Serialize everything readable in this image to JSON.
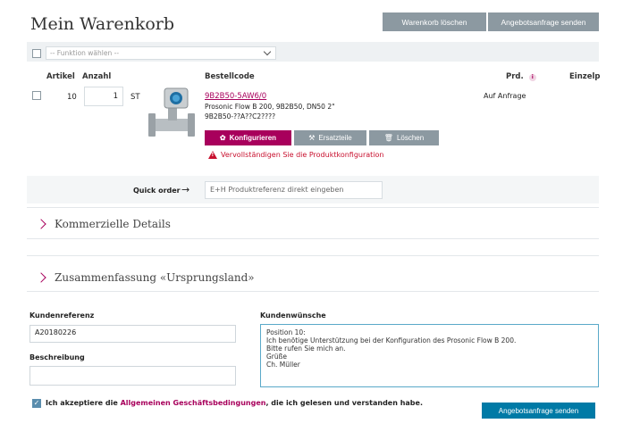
{
  "page": {
    "title": "Mein Warenkorb"
  },
  "toolbar": {
    "clear_cart": "Warenkorb löschen",
    "send_request": "Angebotsanfrage senden"
  },
  "function_select": {
    "placeholder": "-- Funktion wählen --"
  },
  "table": {
    "headers": {
      "item": "Artikel",
      "qty": "Anzahl",
      "code": "Bestellcode",
      "prd": "Prd.",
      "unit_price": "Einzelp"
    },
    "row": {
      "item": "10",
      "qty": "1",
      "unit": "ST",
      "code_link": "9B2B50-5AW6/0",
      "desc1": "Prosonic Flow B 200, 9B2B50, DN50 2\"",
      "desc2": "9B2B50-??A??C2????",
      "availability": "Auf Anfrage",
      "configure": "Konfigurieren",
      "spare_parts": "Ersatzteile",
      "delete": "Löschen",
      "warning": "Vervollständigen Sie die Produktkonfiguration"
    }
  },
  "quick_order": {
    "label": "Quick order",
    "placeholder": "E+H Produktreferenz direkt eingeben"
  },
  "sections": {
    "commercial": "Kommerzielle Details",
    "summary": "Zusammenfassung «Ursprungsland»"
  },
  "form": {
    "ref_label": "Kundenreferenz",
    "ref_value": "A20180226",
    "desc_label": "Beschreibung",
    "desc_value": "",
    "wishes_label": "Kundenwünsche",
    "wishes_value": "Position 10:\nIch benötige Unterstützung bei der Konfiguration des Prosonic Flow B 200.\nBitte rufen Sie mich an.\nGrüße\nCh. Müller"
  },
  "terms": {
    "prefix": "Ich akzeptiere die ",
    "link": "Allgemeinen Geschäftsbedingungen",
    "suffix": ", die ich gelesen und verstanden habe.",
    "checked": true
  },
  "footer": {
    "send_request": "Angebotsanfrage senden"
  },
  "colors": {
    "accent": "#a8005c",
    "button_grey": "#8c99a1",
    "primary_blue": "#007aa6"
  }
}
